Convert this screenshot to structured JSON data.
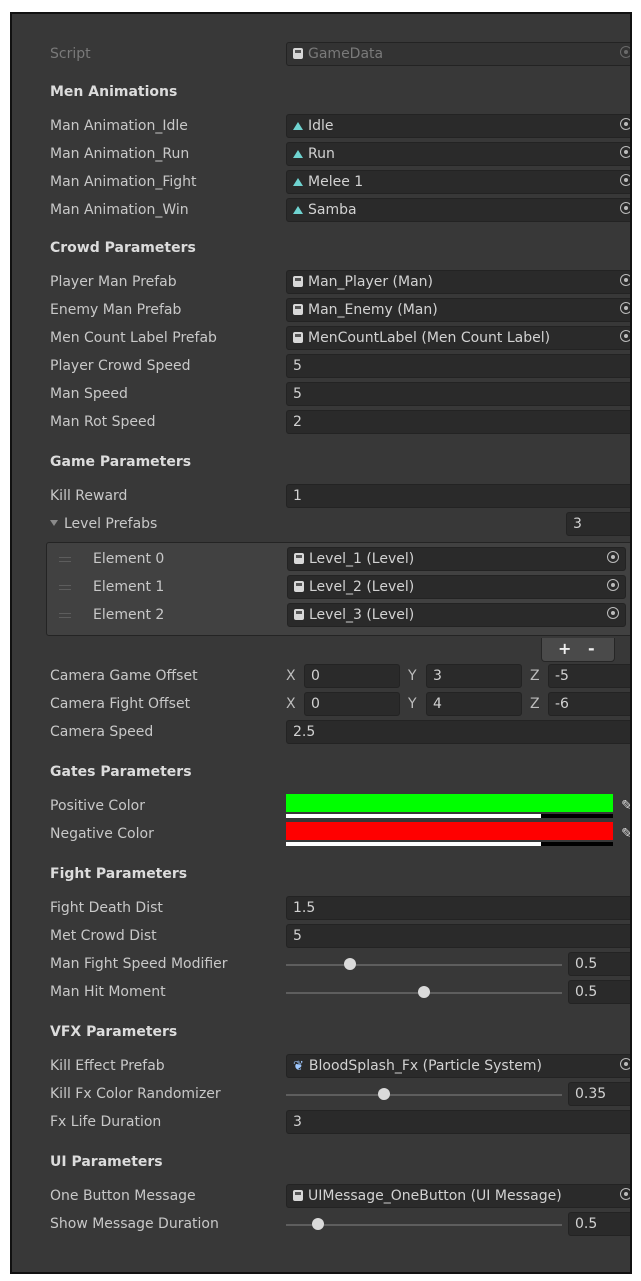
{
  "script_row": {
    "label": "Script",
    "value": "GameData"
  },
  "sections": {
    "men_animations": "Men Animations",
    "crowd_parameters": "Crowd Parameters",
    "game_parameters": "Game Parameters",
    "gates_parameters": "Gates Parameters",
    "fight_parameters": "Fight Parameters",
    "vfx_parameters": "VFX Parameters",
    "ui_parameters": "UI Parameters"
  },
  "men_animations": {
    "idle": {
      "label": "Man Animation_Idle",
      "value": "Idle"
    },
    "run": {
      "label": "Man Animation_Run",
      "value": "Run"
    },
    "fight": {
      "label": "Man Animation_Fight",
      "value": "Melee 1"
    },
    "win": {
      "label": "Man Animation_Win",
      "value": "Samba"
    }
  },
  "crowd": {
    "player_prefab": {
      "label": "Player Man Prefab",
      "value": "Man_Player (Man)"
    },
    "enemy_prefab": {
      "label": "Enemy Man Prefab",
      "value": "Man_Enemy (Man)"
    },
    "count_label": {
      "label": "Men Count Label Prefab",
      "value": "MenCountLabel (Men Count Label)"
    },
    "crowd_speed": {
      "label": "Player Crowd Speed",
      "value": "5"
    },
    "man_speed": {
      "label": "Man Speed",
      "value": "5"
    },
    "rot_speed": {
      "label": "Man Rot Speed",
      "value": "2"
    }
  },
  "game": {
    "kill_reward": {
      "label": "Kill Reward",
      "value": "1"
    },
    "level_prefabs": {
      "label": "Level Prefabs",
      "size": "3"
    },
    "elements": [
      {
        "label": "Element 0",
        "value": "Level_1 (Level)"
      },
      {
        "label": "Element 1",
        "value": "Level_2 (Level)"
      },
      {
        "label": "Element 2",
        "value": "Level_3 (Level)"
      }
    ],
    "plus": "+",
    "minus": "-",
    "camera_game_offset": {
      "label": "Camera Game Offset",
      "x": "0",
      "y": "3",
      "z": "-5"
    },
    "camera_fight_offset": {
      "label": "Camera Fight Offset",
      "x": "0",
      "y": "4",
      "z": "-6"
    },
    "camera_speed": {
      "label": "Camera Speed",
      "value": "2.5"
    },
    "axis": {
      "x": "X",
      "y": "Y",
      "z": "Z"
    }
  },
  "gates": {
    "positive": {
      "label": "Positive Color",
      "color": "#00ff00",
      "alpha": 0.78
    },
    "negative": {
      "label": "Negative Color",
      "color": "#ff0000",
      "alpha": 0.78
    }
  },
  "fight": {
    "death_dist": {
      "label": "Fight Death Dist",
      "value": "1.5"
    },
    "met_crowd_dist": {
      "label": "Met Crowd Dist",
      "value": "5"
    },
    "speed_modifier": {
      "label": "Man Fight Speed Modifier",
      "value": "0.5",
      "fraction": 0.22
    },
    "hit_moment": {
      "label": "Man Hit Moment",
      "value": "0.5",
      "fraction": 0.5
    }
  },
  "vfx": {
    "kill_effect": {
      "label": "Kill Effect Prefab",
      "value": "BloodSplash_Fx (Particle System)"
    },
    "color_randomizer": {
      "label": "Kill Fx Color Randomizer",
      "value": "0.35",
      "fraction": 0.35
    },
    "life_duration": {
      "label": "Fx Life Duration",
      "value": "3"
    }
  },
  "ui": {
    "one_button": {
      "label": "One Button Message",
      "value": "UIMessage_OneButton (UI Message)"
    },
    "show_duration": {
      "label": "Show Message Duration",
      "value": "0.5",
      "fraction": 0.1
    }
  },
  "colors": {
    "panel": "#383838",
    "field": "#2a2a2a",
    "anim_icon": "#6fd3d0"
  }
}
